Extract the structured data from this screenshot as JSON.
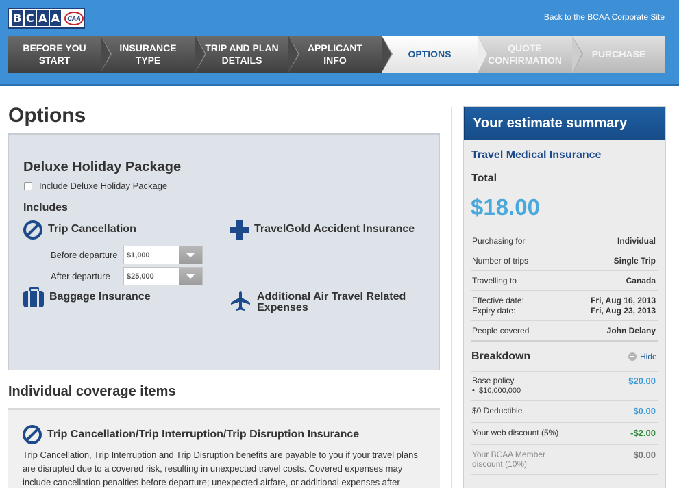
{
  "header": {
    "logo_letters": [
      "B",
      "C",
      "A",
      "A"
    ],
    "logo_badge": "CAA",
    "corporate_link": "Back to the BCAA Corporate Site",
    "brand_color": "#3d8fd6"
  },
  "steps": [
    {
      "label": "BEFORE YOU START",
      "state": "done"
    },
    {
      "label": "INSURANCE TYPE",
      "state": "done"
    },
    {
      "label": "TRIP AND PLAN DETAILS",
      "state": "done"
    },
    {
      "label": "APPLICANT INFO",
      "state": "done"
    },
    {
      "label": "OPTIONS",
      "state": "current"
    },
    {
      "label": "QUOTE CONFIRMATION",
      "state": "future"
    },
    {
      "label": "PURCHASE",
      "state": "future"
    }
  ],
  "main": {
    "title": "Options",
    "package": {
      "title": "Deluxe Holiday Package",
      "checkbox_label": "Include Deluxe Holiday Package",
      "checked": false,
      "includes_label": "Includes",
      "features": [
        {
          "label": "Trip Cancellation",
          "icon": "no-sign-icon"
        },
        {
          "label": "TravelGold Accident Insurance",
          "icon": "medical-cross-icon"
        },
        {
          "label": "Baggage Insurance",
          "icon": "suitcase-icon"
        },
        {
          "label": "Additional Air Travel Related Expenses",
          "icon": "airplane-icon"
        }
      ],
      "before_departure_label": "Before departure",
      "before_departure_value": "$1,000",
      "after_departure_label": "After departure",
      "after_departure_value": "$25,000"
    },
    "individual": {
      "title": "Individual coverage items",
      "item_title": "Trip Cancellation/Trip Interruption/Trip Disruption Insurance",
      "item_text": "Trip Cancellation, Trip Interruption and Trip Disruption benefits are payable to you if your travel plans are disrupted due to a covered risk, resulting in unexpected travel costs. Covered expenses may include cancellation penalties before departure; unexpected airfare, or additional expenses after"
    }
  },
  "summary": {
    "title": "Your estimate summary",
    "product": "Travel Medical Insurance",
    "total_label": "Total",
    "total": "$18.00",
    "rows": [
      {
        "label": "Purchasing for",
        "value": "Individual"
      },
      {
        "label": "Number of trips",
        "value": "Single Trip"
      },
      {
        "label": "Travelling to",
        "value": "Canada"
      },
      {
        "label": "Effective date:",
        "value": "Fri, Aug 16, 2013"
      },
      {
        "label": "Expiry date:",
        "value": "Fri, Aug 23, 2013"
      },
      {
        "label": "People covered",
        "value": "John Delany"
      }
    ],
    "breakdown": {
      "title": "Breakdown",
      "hide_label": "Hide",
      "base_label": "Base policy",
      "base_bullet": "$10,000,000",
      "base_amount": "$20.00",
      "deductible_label": "$0 Deductible",
      "deductible_amount": "$0.00",
      "web_discount_label": "Your web discount (5%)",
      "web_discount_amount": "-$2.00",
      "member_discount_label": "Your BCAA Member discount (10%)",
      "member_discount_amount": "$0.00"
    }
  }
}
